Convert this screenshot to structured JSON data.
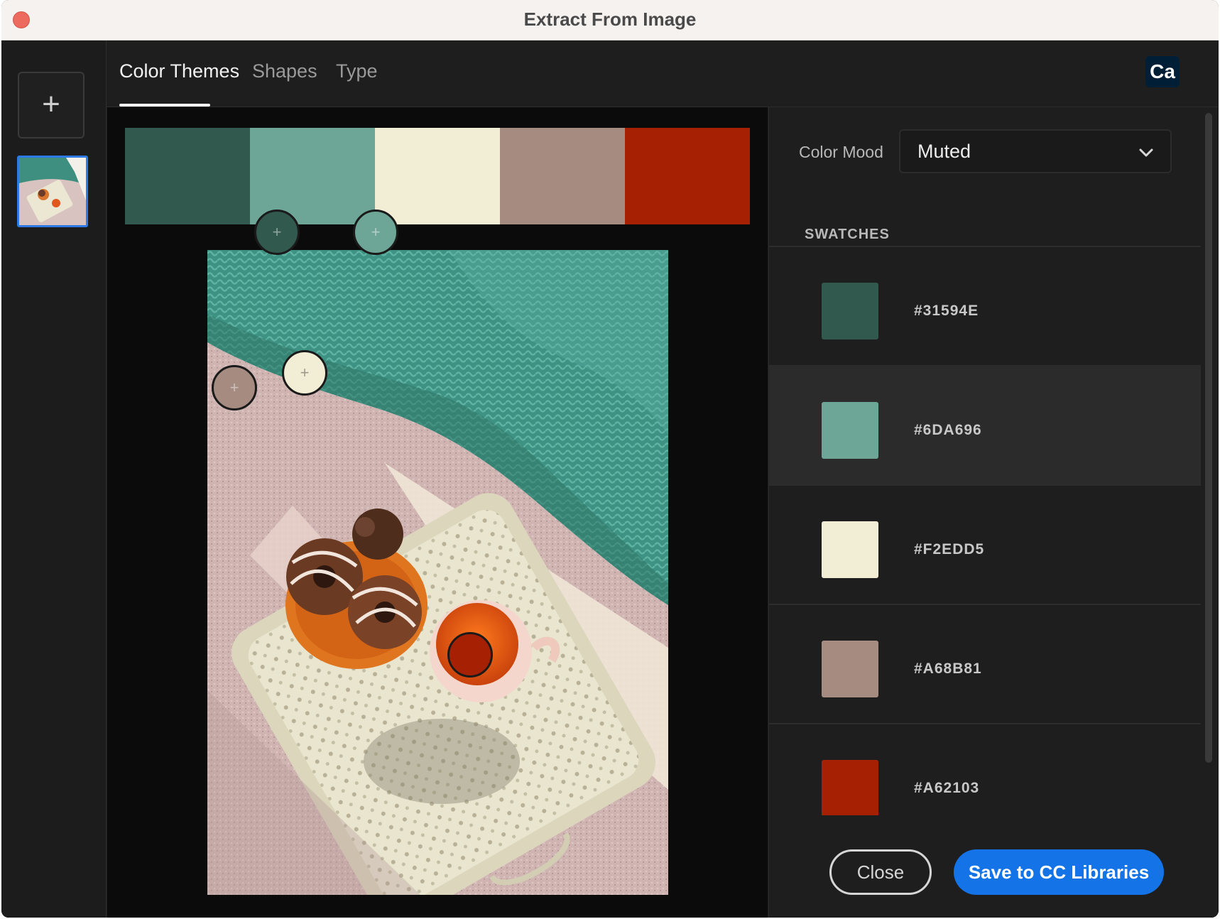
{
  "window": {
    "title": "Extract From Image"
  },
  "sidebar": {
    "add_label": "+"
  },
  "tabs": [
    {
      "label": "Color Themes",
      "active": true
    },
    {
      "label": "Shapes",
      "active": false
    },
    {
      "label": "Type",
      "active": false
    }
  ],
  "app_badge": "Ca",
  "palette": [
    "#31594E",
    "#6DA696",
    "#F2EDD5",
    "#A68B81",
    "#A62103"
  ],
  "panel": {
    "mood_label": "Color Mood",
    "mood_value": "Muted",
    "swatches_title": "SWATCHES",
    "swatches": [
      {
        "hex": "#31594E",
        "selected": false
      },
      {
        "hex": "#6DA696",
        "selected": true
      },
      {
        "hex": "#F2EDD5",
        "selected": false
      },
      {
        "hex": "#A68B81",
        "selected": false
      },
      {
        "hex": "#A62103",
        "selected": false
      }
    ]
  },
  "marker_glyph": "+",
  "actions": {
    "close_label": "Close",
    "save_label": "Save to CC Libraries"
  },
  "colors": {
    "accent": "#1473e6",
    "badge_bg": "#001e36",
    "traffic_close": "#ed6a5e"
  }
}
